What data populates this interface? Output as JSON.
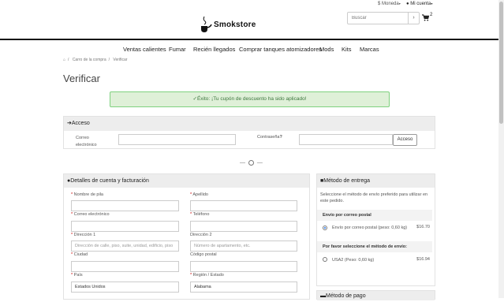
{
  "topbar": {
    "currency_label": "Moneda",
    "account_label": "Mi cuenta"
  },
  "header": {
    "logo_text": "Smokstore",
    "search_placeholder": "Buscar",
    "cart_count": "2"
  },
  "nav": {
    "items": [
      "Ventas calientes",
      "Fumar",
      "Recién llegados",
      "Comprar tanques atomizadores",
      "Mods",
      "Kits",
      "Marcas"
    ]
  },
  "breadcrumb": {
    "items": [
      "Carro de la compra",
      "Verificar"
    ]
  },
  "page": {
    "title": "Verificar"
  },
  "alert": {
    "text": "Éxito: ¡Tu cupón de descuento ha sido aplicado!"
  },
  "login": {
    "heading": "Acceso",
    "email_label": "Correo electrónico",
    "password_label": "Contraseña",
    "button_label": "Acceso"
  },
  "separator": "O",
  "account": {
    "heading": "Detalles de cuenta y facturación",
    "first_name_label": "Nombre de pila",
    "last_name_label": "Apellido",
    "email_label": "Correo electrónico",
    "phone_label": "Teléfono",
    "address1_label": "Dirección 1",
    "address1_placeholder": "Dirección de calle, piso, suite, unidad, edificio, piso",
    "address2_label": "Dirección 2",
    "address2_placeholder": "Número de apartamento, etc.",
    "city_label": "Ciudad",
    "postcode_label": "Código postal",
    "country_label": "País",
    "country_value": "Estados Unidos",
    "region_label": "Región / Estado",
    "region_value": "Alabama"
  },
  "shipping": {
    "heading": "Método de entrega",
    "description": "Seleccione el método de envío preferido para utilizar en este pedido.",
    "group1_title": "Envío por correo postal",
    "group1_option": "Envío por correo postal (peso: 0,60 kg)",
    "group1_price": "$16.70",
    "group2_title": "Por favor seleccione el método de envío:",
    "group2_option": "USA2 (Peso: 0,60 kg)",
    "group2_price": "$16.94"
  },
  "payment": {
    "heading": "Método de pago"
  },
  "colors": {
    "alert_bg": "#dff0d8",
    "alert_border": "#7fd17f",
    "alert_text": "#3c763d",
    "panel_header_bg": "#ededed",
    "required": "#cc0000"
  }
}
